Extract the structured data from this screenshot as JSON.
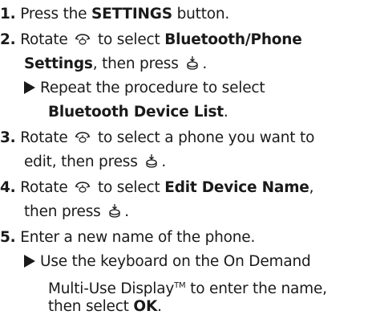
{
  "steps": [
    {
      "number": "1.",
      "parts": [
        "Press the ",
        "SETTINGS",
        " button."
      ]
    },
    {
      "number": "2.",
      "parts": [
        "Rotate",
        "to select ",
        "Bluetooth/Phone",
        "Settings",
        ", then press",
        "."
      ],
      "sub": {
        "text": "Repeat the procedure to select",
        "bold": "Bluetooth Device List",
        "tail": "."
      }
    },
    {
      "number": "3.",
      "parts": [
        "Rotate",
        "to select a phone you want to",
        "edit, then press",
        "."
      ]
    },
    {
      "number": "4.",
      "parts": [
        "Rotate",
        "to select ",
        "Edit Device Name",
        ",",
        "then press",
        "."
      ]
    },
    {
      "number": "5.",
      "parts": [
        "Enter a new name of the phone."
      ],
      "sub": {
        "line1": "Use the keyboard on the On Demand",
        "line2a": "Multi-Use Display",
        "tm": "TM",
        "line2b": " to enter the name,",
        "line3a": "then select ",
        "line3b": "OK",
        "line3c": "."
      }
    }
  ],
  "icons": {
    "rotate": "interface-dial-rotate-icon",
    "press": "interface-dial-press-icon"
  }
}
